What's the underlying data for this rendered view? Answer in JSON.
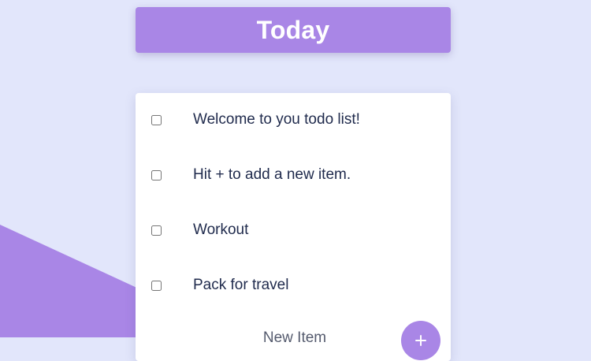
{
  "header": {
    "title": "Today"
  },
  "todos": [
    {
      "label": "Welcome to you todo list!",
      "checked": false
    },
    {
      "label": "Hit + to add a new item.",
      "checked": false
    },
    {
      "label": "Workout",
      "checked": false
    },
    {
      "label": "Pack for travel",
      "checked": false
    }
  ],
  "new_item": {
    "placeholder": "New Item",
    "value": ""
  },
  "add_button": {
    "icon": "plus-icon"
  },
  "colors": {
    "background": "#E2E6FB",
    "accent": "#A986E6",
    "text": "#1F2A4C",
    "card": "#FFFFFF"
  }
}
